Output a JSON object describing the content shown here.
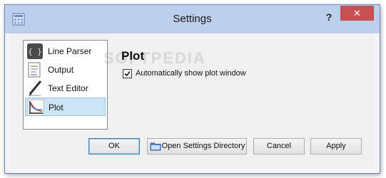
{
  "window": {
    "title": "Settings",
    "help_label": "?",
    "close_label": "✕"
  },
  "sidebar": {
    "items": [
      {
        "label": "Line Parser",
        "icon": "line-parser-icon"
      },
      {
        "label": "Output",
        "icon": "output-icon"
      },
      {
        "label": "Text Editor",
        "icon": "text-editor-icon"
      },
      {
        "label": "Plot",
        "icon": "plot-icon",
        "selected": true
      }
    ]
  },
  "main": {
    "heading": "Plot",
    "auto_show_plot": {
      "label": "Automatically show plot window",
      "checked": true
    }
  },
  "buttons": {
    "ok": "OK",
    "open_settings_dir": "Open Settings Directory",
    "cancel": "Cancel",
    "apply": "Apply"
  },
  "watermark": "SOFTPEDIA",
  "colors": {
    "titlebar": "#bcd0ee",
    "close_button": "#c75050",
    "selection": "#cce4f7"
  }
}
